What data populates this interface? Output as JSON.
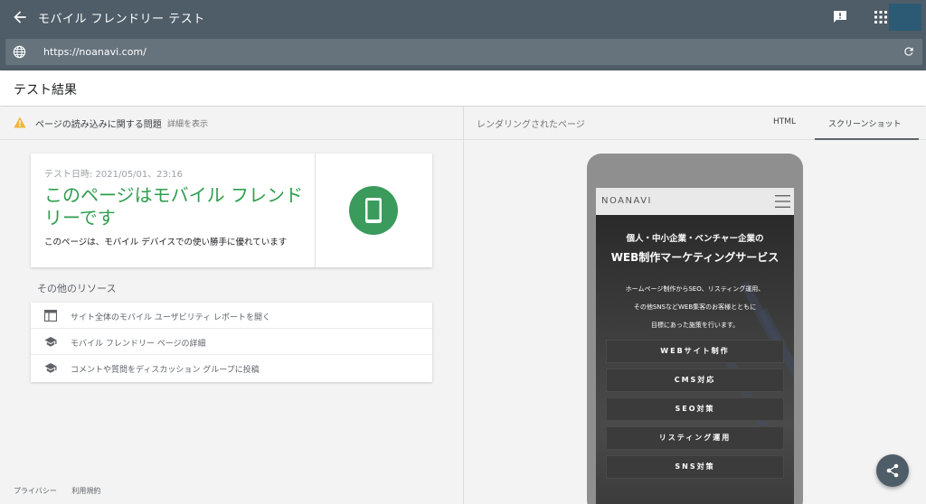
{
  "app": {
    "title": "モバイル フレンドリー テスト",
    "url": "https://noanavi.com/",
    "brand_color": "#4e5d68"
  },
  "results": {
    "title": "テスト結果"
  },
  "issues": {
    "label": "ページの読み込みに関する問題",
    "detail_link": "詳細を表示"
  },
  "result_card": {
    "date": "テスト日時: 2021/05/01、23:16",
    "headline": "このページはモバイル フレンドリーです",
    "description": "このページは、モバイル デバイスでの使い勝手に優れています",
    "success_color": "#2e9e4e"
  },
  "resources": {
    "title": "その他のリソース",
    "items": [
      {
        "icon": "web-icon",
        "label": "サイト全体のモバイル ユーザビリティ レポートを開く"
      },
      {
        "icon": "school-icon",
        "label": "モバイル フレンドリー ページの詳細"
      },
      {
        "icon": "school-icon",
        "label": "コメントや質問をディスカッション グループに投稿"
      }
    ]
  },
  "footer": {
    "privacy": "プライバシー",
    "terms": "利用規約"
  },
  "rendered": {
    "label": "レンダリングされたページ",
    "tabs": [
      {
        "label": "HTML",
        "active": false
      },
      {
        "label": "スクリーンショット",
        "active": true
      }
    ]
  },
  "preview": {
    "logo": "NOANAVI",
    "subtitle": "個人・中小企業・ベンチャー企業の",
    "title": "WEB制作マーケティングサービス",
    "body": [
      "ホームページ制作からSEO、リスティング運用、",
      "その他SNSなどWEB集客のお客様とともに",
      "目標にあった施策を行います。"
    ],
    "buttons": [
      "WEBサイト制作",
      "CMS対応",
      "SEO対策",
      "リスティング運用",
      "SNS対策"
    ]
  }
}
